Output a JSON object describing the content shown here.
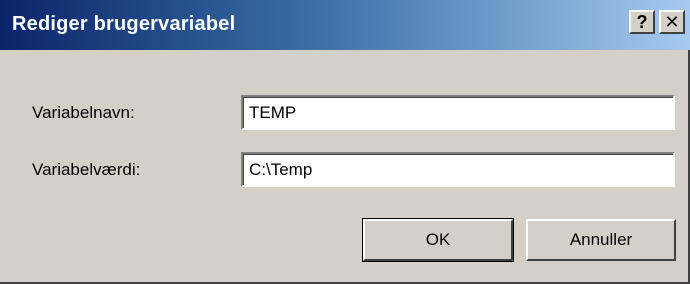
{
  "window": {
    "title": "Rediger brugervariabel",
    "help_glyph": "?",
    "close_glyph": "✕"
  },
  "form": {
    "name_label": "Variabelnavn:",
    "name_value": "TEMP",
    "value_label": "Variabelværdi:",
    "value_value": "C:\\Temp"
  },
  "buttons": {
    "ok_label": "OK",
    "cancel_label": "Annuller"
  },
  "colors": {
    "title_gradient_start": "#0a246a",
    "title_gradient_end": "#a6caf0",
    "face": "#d4d0c8"
  }
}
